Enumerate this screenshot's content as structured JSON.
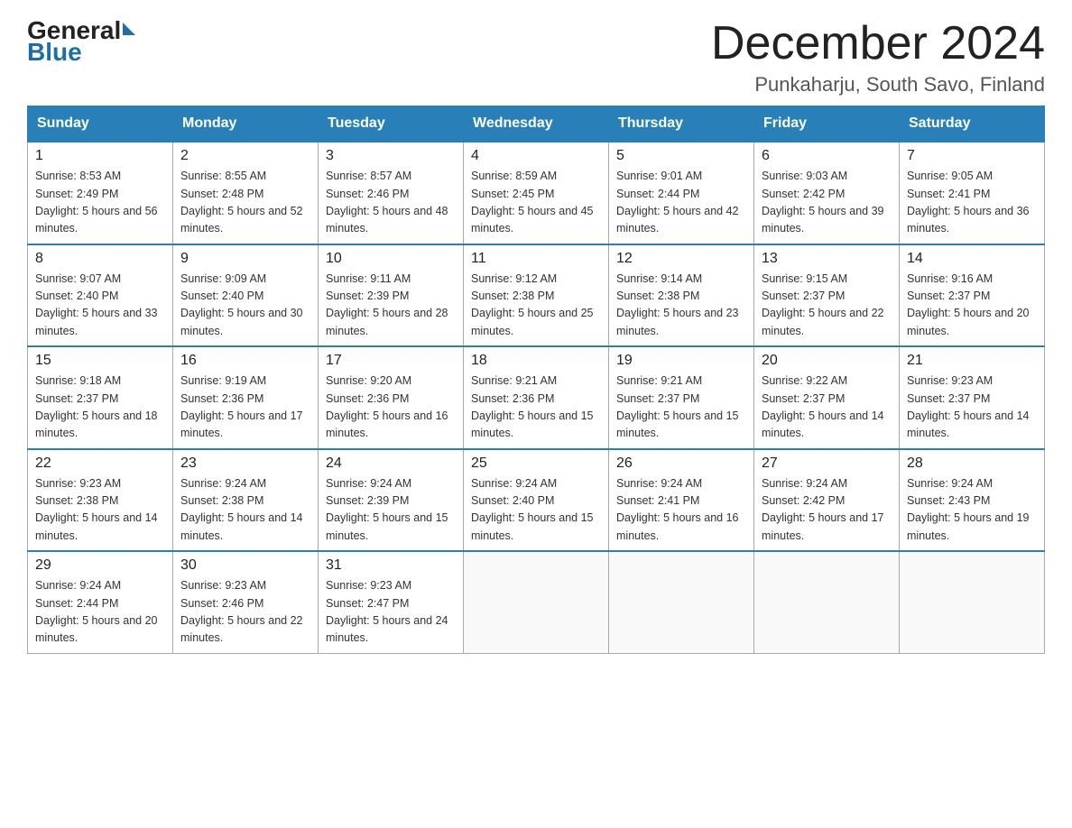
{
  "header": {
    "logo": {
      "part1": "General",
      "part2": "Blue"
    },
    "title": "December 2024",
    "location": "Punkaharju, South Savo, Finland"
  },
  "days_of_week": [
    "Sunday",
    "Monday",
    "Tuesday",
    "Wednesday",
    "Thursday",
    "Friday",
    "Saturday"
  ],
  "weeks": [
    [
      {
        "day": "1",
        "sunrise": "Sunrise: 8:53 AM",
        "sunset": "Sunset: 2:49 PM",
        "daylight": "Daylight: 5 hours and 56 minutes."
      },
      {
        "day": "2",
        "sunrise": "Sunrise: 8:55 AM",
        "sunset": "Sunset: 2:48 PM",
        "daylight": "Daylight: 5 hours and 52 minutes."
      },
      {
        "day": "3",
        "sunrise": "Sunrise: 8:57 AM",
        "sunset": "Sunset: 2:46 PM",
        "daylight": "Daylight: 5 hours and 48 minutes."
      },
      {
        "day": "4",
        "sunrise": "Sunrise: 8:59 AM",
        "sunset": "Sunset: 2:45 PM",
        "daylight": "Daylight: 5 hours and 45 minutes."
      },
      {
        "day": "5",
        "sunrise": "Sunrise: 9:01 AM",
        "sunset": "Sunset: 2:44 PM",
        "daylight": "Daylight: 5 hours and 42 minutes."
      },
      {
        "day": "6",
        "sunrise": "Sunrise: 9:03 AM",
        "sunset": "Sunset: 2:42 PM",
        "daylight": "Daylight: 5 hours and 39 minutes."
      },
      {
        "day": "7",
        "sunrise": "Sunrise: 9:05 AM",
        "sunset": "Sunset: 2:41 PM",
        "daylight": "Daylight: 5 hours and 36 minutes."
      }
    ],
    [
      {
        "day": "8",
        "sunrise": "Sunrise: 9:07 AM",
        "sunset": "Sunset: 2:40 PM",
        "daylight": "Daylight: 5 hours and 33 minutes."
      },
      {
        "day": "9",
        "sunrise": "Sunrise: 9:09 AM",
        "sunset": "Sunset: 2:40 PM",
        "daylight": "Daylight: 5 hours and 30 minutes."
      },
      {
        "day": "10",
        "sunrise": "Sunrise: 9:11 AM",
        "sunset": "Sunset: 2:39 PM",
        "daylight": "Daylight: 5 hours and 28 minutes."
      },
      {
        "day": "11",
        "sunrise": "Sunrise: 9:12 AM",
        "sunset": "Sunset: 2:38 PM",
        "daylight": "Daylight: 5 hours and 25 minutes."
      },
      {
        "day": "12",
        "sunrise": "Sunrise: 9:14 AM",
        "sunset": "Sunset: 2:38 PM",
        "daylight": "Daylight: 5 hours and 23 minutes."
      },
      {
        "day": "13",
        "sunrise": "Sunrise: 9:15 AM",
        "sunset": "Sunset: 2:37 PM",
        "daylight": "Daylight: 5 hours and 22 minutes."
      },
      {
        "day": "14",
        "sunrise": "Sunrise: 9:16 AM",
        "sunset": "Sunset: 2:37 PM",
        "daylight": "Daylight: 5 hours and 20 minutes."
      }
    ],
    [
      {
        "day": "15",
        "sunrise": "Sunrise: 9:18 AM",
        "sunset": "Sunset: 2:37 PM",
        "daylight": "Daylight: 5 hours and 18 minutes."
      },
      {
        "day": "16",
        "sunrise": "Sunrise: 9:19 AM",
        "sunset": "Sunset: 2:36 PM",
        "daylight": "Daylight: 5 hours and 17 minutes."
      },
      {
        "day": "17",
        "sunrise": "Sunrise: 9:20 AM",
        "sunset": "Sunset: 2:36 PM",
        "daylight": "Daylight: 5 hours and 16 minutes."
      },
      {
        "day": "18",
        "sunrise": "Sunrise: 9:21 AM",
        "sunset": "Sunset: 2:36 PM",
        "daylight": "Daylight: 5 hours and 15 minutes."
      },
      {
        "day": "19",
        "sunrise": "Sunrise: 9:21 AM",
        "sunset": "Sunset: 2:37 PM",
        "daylight": "Daylight: 5 hours and 15 minutes."
      },
      {
        "day": "20",
        "sunrise": "Sunrise: 9:22 AM",
        "sunset": "Sunset: 2:37 PM",
        "daylight": "Daylight: 5 hours and 14 minutes."
      },
      {
        "day": "21",
        "sunrise": "Sunrise: 9:23 AM",
        "sunset": "Sunset: 2:37 PM",
        "daylight": "Daylight: 5 hours and 14 minutes."
      }
    ],
    [
      {
        "day": "22",
        "sunrise": "Sunrise: 9:23 AM",
        "sunset": "Sunset: 2:38 PM",
        "daylight": "Daylight: 5 hours and 14 minutes."
      },
      {
        "day": "23",
        "sunrise": "Sunrise: 9:24 AM",
        "sunset": "Sunset: 2:38 PM",
        "daylight": "Daylight: 5 hours and 14 minutes."
      },
      {
        "day": "24",
        "sunrise": "Sunrise: 9:24 AM",
        "sunset": "Sunset: 2:39 PM",
        "daylight": "Daylight: 5 hours and 15 minutes."
      },
      {
        "day": "25",
        "sunrise": "Sunrise: 9:24 AM",
        "sunset": "Sunset: 2:40 PM",
        "daylight": "Daylight: 5 hours and 15 minutes."
      },
      {
        "day": "26",
        "sunrise": "Sunrise: 9:24 AM",
        "sunset": "Sunset: 2:41 PM",
        "daylight": "Daylight: 5 hours and 16 minutes."
      },
      {
        "day": "27",
        "sunrise": "Sunrise: 9:24 AM",
        "sunset": "Sunset: 2:42 PM",
        "daylight": "Daylight: 5 hours and 17 minutes."
      },
      {
        "day": "28",
        "sunrise": "Sunrise: 9:24 AM",
        "sunset": "Sunset: 2:43 PM",
        "daylight": "Daylight: 5 hours and 19 minutes."
      }
    ],
    [
      {
        "day": "29",
        "sunrise": "Sunrise: 9:24 AM",
        "sunset": "Sunset: 2:44 PM",
        "daylight": "Daylight: 5 hours and 20 minutes."
      },
      {
        "day": "30",
        "sunrise": "Sunrise: 9:23 AM",
        "sunset": "Sunset: 2:46 PM",
        "daylight": "Daylight: 5 hours and 22 minutes."
      },
      {
        "day": "31",
        "sunrise": "Sunrise: 9:23 AM",
        "sunset": "Sunset: 2:47 PM",
        "daylight": "Daylight: 5 hours and 24 minutes."
      },
      {
        "day": "",
        "sunrise": "",
        "sunset": "",
        "daylight": ""
      },
      {
        "day": "",
        "sunrise": "",
        "sunset": "",
        "daylight": ""
      },
      {
        "day": "",
        "sunrise": "",
        "sunset": "",
        "daylight": ""
      },
      {
        "day": "",
        "sunrise": "",
        "sunset": "",
        "daylight": ""
      }
    ]
  ]
}
